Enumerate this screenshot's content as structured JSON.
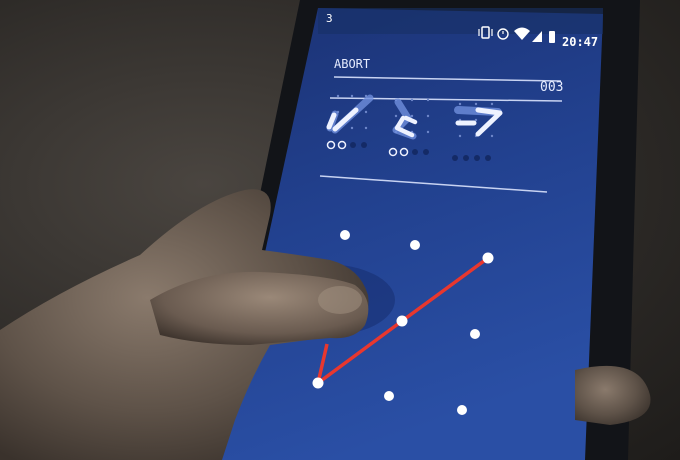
{
  "status_bar": {
    "notification_count": "3",
    "time": "20:47",
    "icons": [
      "vibrate-icon",
      "alarm-icon",
      "wifi-icon",
      "cell-signal-icon",
      "battery-icon"
    ]
  },
  "app": {
    "abort_label": "ABORT",
    "counter": "003",
    "pattern_points_label": "pattern-dot",
    "stroke_color": "#e8372e",
    "screen_color": "#1f3c8f"
  },
  "glyphs": [
    {
      "name": "glyph-1",
      "name_icon": "check-stroke-icon",
      "marker_count": 2
    },
    {
      "name": "glyph-2",
      "name_icon": "zigzag-stroke-icon",
      "marker_count": 2
    },
    {
      "name": "glyph-3",
      "name_icon": "seven-stroke-icon",
      "marker_count": 0
    }
  ]
}
